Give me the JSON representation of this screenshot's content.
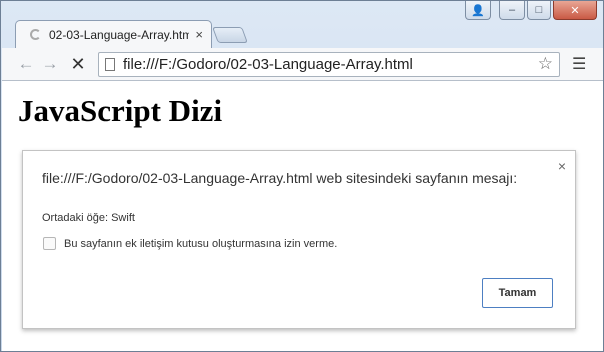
{
  "window": {
    "caption_buttons": {
      "user": "user-icon",
      "minimize": "–",
      "maximize": "□",
      "close": "✕"
    }
  },
  "tab": {
    "title": "02-03-Language-Array.htm",
    "close_icon": "×"
  },
  "toolbar": {
    "back_icon": "←",
    "forward_icon": "→",
    "stop_icon": "✕",
    "url": "file:///F:/Godoro/02-03-Language-Array.html",
    "star_icon": "☆",
    "menu_icon": "☰"
  },
  "page": {
    "heading": "JavaScript Dizi"
  },
  "dialog": {
    "title": "file:///F:/Godoro/02-03-Language-Array.html web sitesindeki sayfanın mesajı:",
    "message": "Ortadaki öğe: Swift",
    "checkbox_label": "Bu sayfanın ek iletişim kutusu oluşturmasına izin verme.",
    "ok_label": "Tamam",
    "close_icon": "×"
  }
}
